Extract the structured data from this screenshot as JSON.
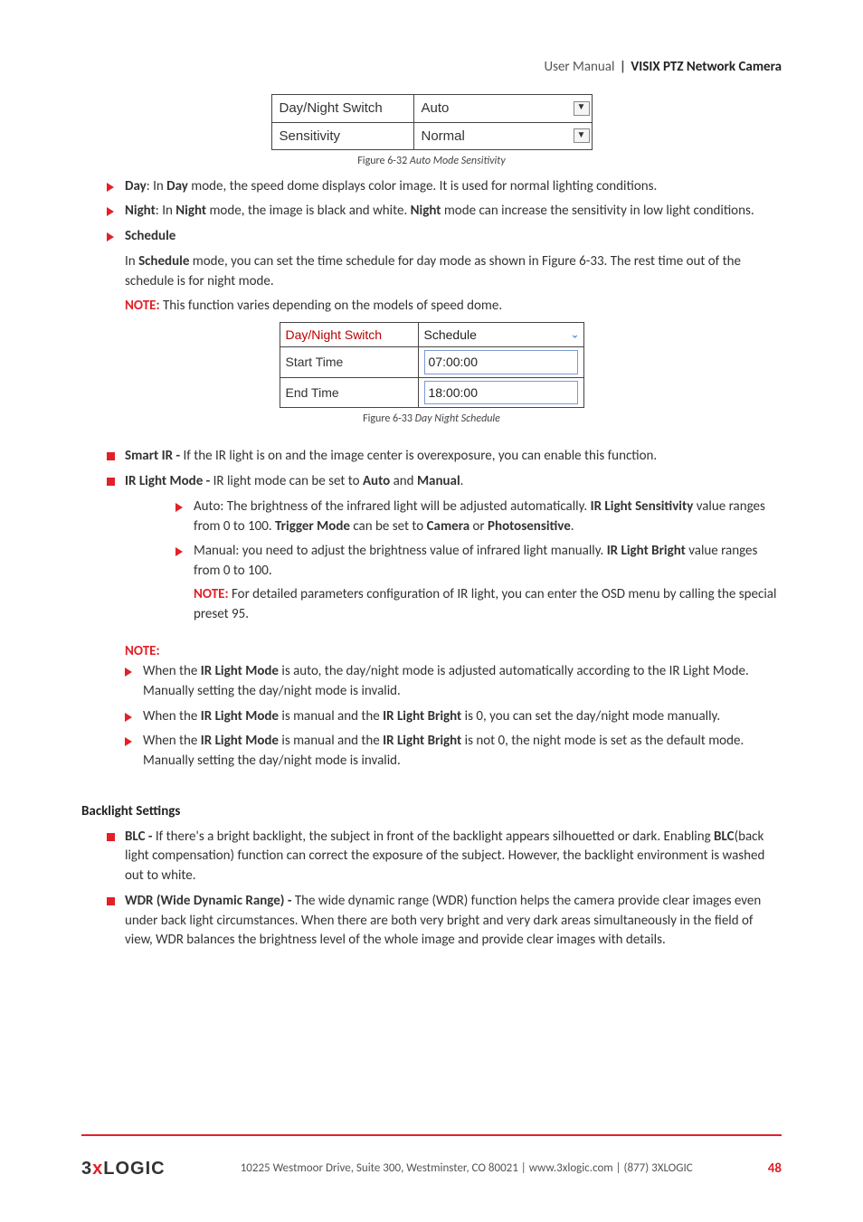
{
  "header": {
    "um": "User Manual",
    "prod": "VISIX PTZ Network Camera"
  },
  "fig1": {
    "rows": [
      {
        "label": "Day/Night Switch",
        "value": "Auto"
      },
      {
        "label": "Sensitivity",
        "value": "Normal"
      }
    ],
    "caption_pre": "Figure 6-32",
    "caption_it": "Auto Mode Sensitivity"
  },
  "bullets1": {
    "day_label": "Day",
    "day_text1": ":   In ",
    "day_text2": " mode, the speed dome displays color image. It is used for normal lighting conditions.",
    "night_label": "Night",
    "night_text1": ":   In ",
    "night_text2": " mode, the image is black and white. ",
    "night_text3": " mode can increase the sensitivity in low light conditions.",
    "schedule_label": "Schedule",
    "schedule_para": "In Schedule mode, you can set the time schedule for day mode as shown in Figure 6-33. The rest time out of the schedule is for night mode.",
    "schedule_note": " This function varies depending on the models of speed dome."
  },
  "fig2": {
    "rows": [
      {
        "label": "Day/Night Switch",
        "value": "Schedule",
        "dd": true
      },
      {
        "label": "Start Time",
        "value": "07:00:00"
      },
      {
        "label": "End Time",
        "value": "18:00:00"
      }
    ],
    "caption_pre": "Figure 6-33",
    "caption_it": "Day Night Schedule"
  },
  "section2": {
    "smart_label": "Smart IR -",
    "smart_text": " If the IR light is on and the image center is overexposure, you can enable this function.",
    "irmode_label": "IR Light Mode -",
    "irmode_text": " IR light mode can be set to Auto and Manual.",
    "auto_pre": "Auto: The brightness of the infrared light will be adjusted automatically. ",
    "auto_b1": "IR Light Sensitivity",
    "auto_mid": " value ranges from 0 to 100. ",
    "auto_b2": "Trigger Mode",
    "auto_mid2": " can be set to ",
    "auto_b3": "Camera",
    "auto_or": " or ",
    "auto_b4": "Photosensitive",
    "auto_end": ".",
    "manual_pre": "Manual: you need to adjust the brightness value of infrared light manually. ",
    "manual_b": "IR Light Bright",
    "manual_end": " value ranges from 0 to 100.",
    "manual_note": " For detailed parameters configuration of IR light, you can enter the OSD menu by calling the special preset 95."
  },
  "notes": {
    "heading": "NOTE:",
    "n1_pre": "When the ",
    "n1_b": "IR Light Mode",
    "n1_end": " is auto, the day/night mode is adjusted automatically according to the IR Light Mode. Manually setting the day/night mode is invalid.",
    "n2_pre": "When the ",
    "n2_b1": "IR Light Mode",
    "n2_mid": " is manual and the ",
    "n2_b2": "IR Light Bright",
    "n2_end": " is 0, you can set the day/night mode manually.",
    "n3_pre": "When the ",
    "n3_b1": "IR Light Mode",
    "n3_mid": " is manual and the ",
    "n3_b2": "IR Light Bright",
    "n3_end": " is not 0, the night mode is set as the default mode. Manually setting the day/night mode is invalid."
  },
  "backlight": {
    "heading": "Backlight Settings",
    "blc_label": "BLC -",
    "blc_text": " If there's a bright backlight, the subject in front of the backlight appears silhouetted or dark. Enabling BLC(back light compensation) function can correct the exposure of the subject. However, the backlight environment is washed out to white.",
    "wdr_label": "WDR (Wide Dynamic Range) -",
    "wdr_text": " The wide dynamic range (WDR) function helps the camera provide clear images even under back light circumstances. When there are both very bright and very dark areas simultaneously in the field of view, WDR balances the brightness level of the whole image and provide clear images with details."
  },
  "footer": {
    "addr": "10225 Westmoor Drive, Suite 300, Westminster, CO 80021 | www.3xlogic.com | (877) 3XLOGIC",
    "page": "48",
    "logo_pre": "3",
    "logo_x": "x",
    "logo_post": "LOGIC"
  },
  "note_label": "NOTE:"
}
